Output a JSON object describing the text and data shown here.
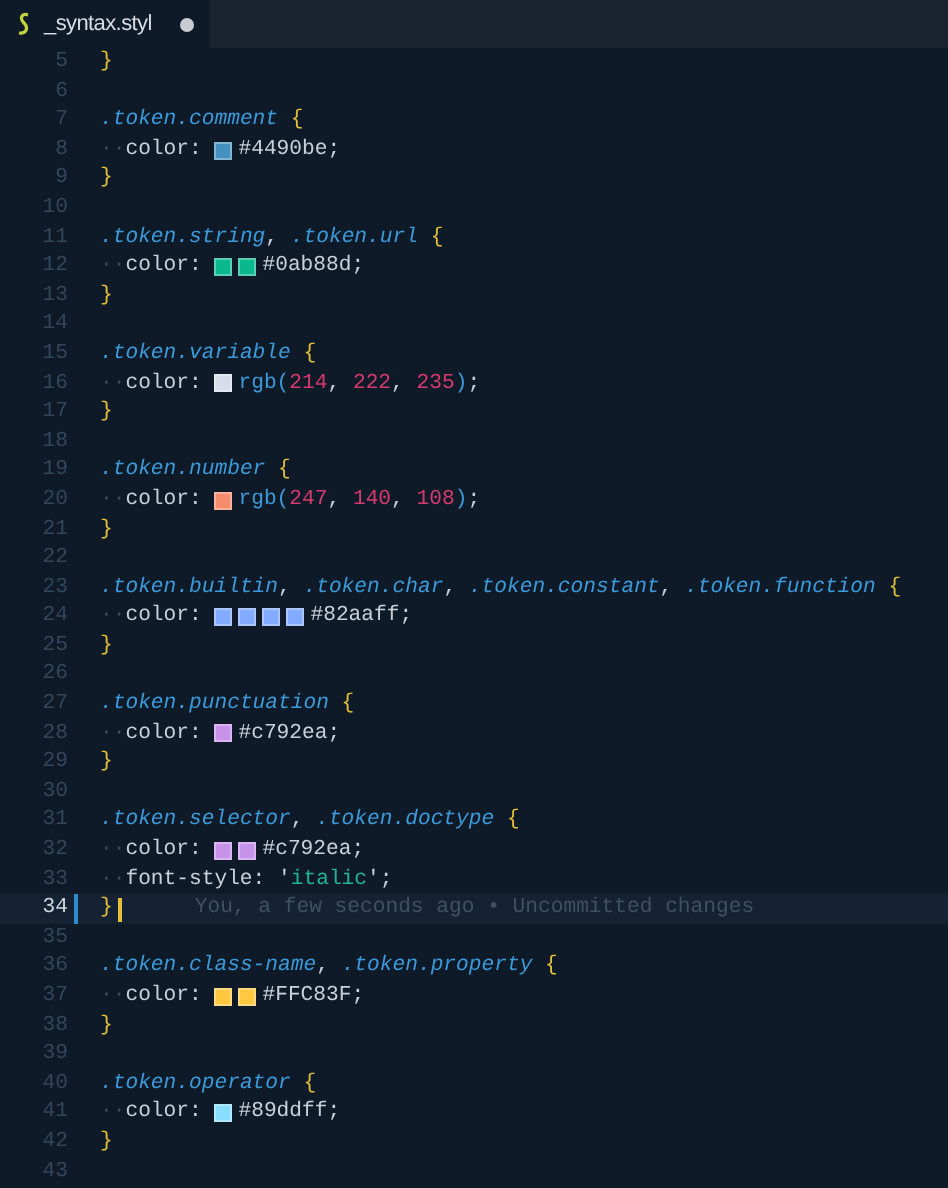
{
  "tab": {
    "title": "_syntax.styl",
    "selected": true,
    "modified": true
  },
  "lines": [
    {
      "number": "5",
      "tokens": [
        {
          "kind": "brace",
          "text": "}"
        }
      ]
    },
    {
      "number": "6"
    },
    {
      "number": "7",
      "tokens": [
        {
          "kind": "sel",
          "text": ".token"
        },
        {
          "kind": "sel",
          "text": ".comment"
        },
        {
          "kind": "brace",
          "text": " {"
        }
      ]
    },
    {
      "number": "8",
      "tokens": [
        {
          "kind": "ws",
          "text": "··"
        },
        {
          "kind": "prop",
          "text": "color: "
        },
        {
          "kind": "swatch",
          "color": "#4490be"
        },
        {
          "kind": "hex",
          "text": "#4490be;"
        }
      ]
    },
    {
      "number": "9",
      "tokens": [
        {
          "kind": "brace",
          "text": "}"
        }
      ]
    },
    {
      "number": "10"
    },
    {
      "number": "11",
      "tokens": [
        {
          "kind": "sel",
          "text": ".token"
        },
        {
          "kind": "sel",
          "text": ".string"
        },
        {
          "kind": "punct",
          "text": ", "
        },
        {
          "kind": "sel",
          "text": ".token"
        },
        {
          "kind": "sel",
          "text": ".url"
        },
        {
          "kind": "brace",
          "text": " {"
        }
      ]
    },
    {
      "number": "12",
      "tokens": [
        {
          "kind": "ws",
          "text": "··"
        },
        {
          "kind": "prop",
          "text": "color: "
        },
        {
          "kind": "swatch",
          "color": "#0ab88d"
        },
        {
          "kind": "swatch",
          "color": "#0ab88d"
        },
        {
          "kind": "hex",
          "text": "#0ab88d;"
        }
      ]
    },
    {
      "number": "13",
      "tokens": [
        {
          "kind": "brace",
          "text": "}"
        }
      ]
    },
    {
      "number": "14"
    },
    {
      "number": "15",
      "tokens": [
        {
          "kind": "sel",
          "text": ".token"
        },
        {
          "kind": "sel",
          "text": ".variable"
        },
        {
          "kind": "brace",
          "text": " {"
        }
      ]
    },
    {
      "number": "16",
      "tokens": [
        {
          "kind": "ws",
          "text": "··"
        },
        {
          "kind": "prop",
          "text": "color: "
        },
        {
          "kind": "swatch",
          "color": "#d6deeb"
        },
        {
          "kind": "func",
          "text": "rgb("
        },
        {
          "kind": "num",
          "text": "214"
        },
        {
          "kind": "punct",
          "text": ", "
        },
        {
          "kind": "num",
          "text": "222"
        },
        {
          "kind": "punct",
          "text": ", "
        },
        {
          "kind": "num",
          "text": "235"
        },
        {
          "kind": "func",
          "text": ")"
        },
        {
          "kind": "punct",
          "text": ";"
        }
      ]
    },
    {
      "number": "17",
      "tokens": [
        {
          "kind": "brace",
          "text": "}"
        }
      ]
    },
    {
      "number": "18"
    },
    {
      "number": "19",
      "tokens": [
        {
          "kind": "sel",
          "text": ".token"
        },
        {
          "kind": "sel",
          "text": ".number"
        },
        {
          "kind": "brace",
          "text": " {"
        }
      ]
    },
    {
      "number": "20",
      "tokens": [
        {
          "kind": "ws",
          "text": "··"
        },
        {
          "kind": "prop",
          "text": "color: "
        },
        {
          "kind": "swatch",
          "color": "#f78c6c"
        },
        {
          "kind": "func",
          "text": "rgb("
        },
        {
          "kind": "num",
          "text": "247"
        },
        {
          "kind": "punct",
          "text": ", "
        },
        {
          "kind": "num",
          "text": "140"
        },
        {
          "kind": "punct",
          "text": ", "
        },
        {
          "kind": "num",
          "text": "108"
        },
        {
          "kind": "func",
          "text": ")"
        },
        {
          "kind": "punct",
          "text": ";"
        }
      ]
    },
    {
      "number": "21",
      "tokens": [
        {
          "kind": "brace",
          "text": "}"
        }
      ]
    },
    {
      "number": "22"
    },
    {
      "number": "23",
      "tokens": [
        {
          "kind": "sel",
          "text": ".token"
        },
        {
          "kind": "sel",
          "text": ".builtin"
        },
        {
          "kind": "punct",
          "text": ", "
        },
        {
          "kind": "sel",
          "text": ".token"
        },
        {
          "kind": "sel",
          "text": ".char"
        },
        {
          "kind": "punct",
          "text": ", "
        },
        {
          "kind": "sel",
          "text": ".token"
        },
        {
          "kind": "sel",
          "text": ".constant"
        },
        {
          "kind": "punct",
          "text": ", "
        },
        {
          "kind": "sel",
          "text": ".token"
        },
        {
          "kind": "sel",
          "text": ".function"
        },
        {
          "kind": "brace",
          "text": " {"
        }
      ]
    },
    {
      "number": "24",
      "tokens": [
        {
          "kind": "ws",
          "text": "··"
        },
        {
          "kind": "prop",
          "text": "color: "
        },
        {
          "kind": "swatch",
          "color": "#82aaff"
        },
        {
          "kind": "swatch",
          "color": "#82aaff"
        },
        {
          "kind": "swatch",
          "color": "#82aaff"
        },
        {
          "kind": "swatch",
          "color": "#82aaff"
        },
        {
          "kind": "hex",
          "text": "#82aaff;"
        }
      ]
    },
    {
      "number": "25",
      "tokens": [
        {
          "kind": "brace",
          "text": "}"
        }
      ]
    },
    {
      "number": "26"
    },
    {
      "number": "27",
      "tokens": [
        {
          "kind": "sel",
          "text": ".token"
        },
        {
          "kind": "sel",
          "text": ".punctuation"
        },
        {
          "kind": "brace",
          "text": " {"
        }
      ]
    },
    {
      "number": "28",
      "tokens": [
        {
          "kind": "ws",
          "text": "··"
        },
        {
          "kind": "prop",
          "text": "color: "
        },
        {
          "kind": "swatch",
          "color": "#c792ea"
        },
        {
          "kind": "hex",
          "text": "#c792ea;"
        }
      ]
    },
    {
      "number": "29",
      "tokens": [
        {
          "kind": "brace",
          "text": "}"
        }
      ]
    },
    {
      "number": "30"
    },
    {
      "number": "31",
      "tokens": [
        {
          "kind": "sel",
          "text": ".token"
        },
        {
          "kind": "sel",
          "text": ".selector"
        },
        {
          "kind": "punct",
          "text": ", "
        },
        {
          "kind": "sel",
          "text": ".token"
        },
        {
          "kind": "sel",
          "text": ".doctype"
        },
        {
          "kind": "brace",
          "text": " {"
        }
      ]
    },
    {
      "number": "32",
      "tokens": [
        {
          "kind": "ws",
          "text": "··"
        },
        {
          "kind": "prop",
          "text": "color: "
        },
        {
          "kind": "swatch",
          "color": "#c792ea"
        },
        {
          "kind": "swatch",
          "color": "#c792ea"
        },
        {
          "kind": "hex",
          "text": "#c792ea;"
        }
      ]
    },
    {
      "number": "33",
      "tokens": [
        {
          "kind": "ws",
          "text": "··"
        },
        {
          "kind": "prop",
          "text": "font-style: '"
        },
        {
          "kind": "str",
          "text": "italic"
        },
        {
          "kind": "punct",
          "text": "';"
        }
      ]
    },
    {
      "number": "34",
      "current": true,
      "modified": true,
      "blame": "You, a few seconds ago • Uncommitted changes",
      "tokens": [
        {
          "kind": "brace",
          "text": "}"
        }
      ]
    },
    {
      "number": "35"
    },
    {
      "number": "36",
      "tokens": [
        {
          "kind": "sel",
          "text": ".token"
        },
        {
          "kind": "sel",
          "text": ".class-name"
        },
        {
          "kind": "punct",
          "text": ", "
        },
        {
          "kind": "sel",
          "text": ".token"
        },
        {
          "kind": "sel",
          "text": ".property"
        },
        {
          "kind": "brace",
          "text": " {"
        }
      ]
    },
    {
      "number": "37",
      "tokens": [
        {
          "kind": "ws",
          "text": "··"
        },
        {
          "kind": "prop",
          "text": "color: "
        },
        {
          "kind": "swatch",
          "color": "#ffc83f"
        },
        {
          "kind": "swatch",
          "color": "#ffc83f"
        },
        {
          "kind": "hex",
          "text": "#FFC83F;"
        }
      ]
    },
    {
      "number": "38",
      "tokens": [
        {
          "kind": "brace",
          "text": "}"
        }
      ]
    },
    {
      "number": "39"
    },
    {
      "number": "40",
      "tokens": [
        {
          "kind": "sel",
          "text": ".token"
        },
        {
          "kind": "sel",
          "text": ".operator"
        },
        {
          "kind": "brace",
          "text": " {"
        }
      ]
    },
    {
      "number": "41",
      "tokens": [
        {
          "kind": "ws",
          "text": "··"
        },
        {
          "kind": "prop",
          "text": "color: "
        },
        {
          "kind": "swatch",
          "color": "#89ddff"
        },
        {
          "kind": "hex",
          "text": "#89ddff;"
        }
      ]
    },
    {
      "number": "42",
      "tokens": [
        {
          "kind": "brace",
          "text": "}"
        }
      ]
    },
    {
      "number": "43"
    }
  ]
}
